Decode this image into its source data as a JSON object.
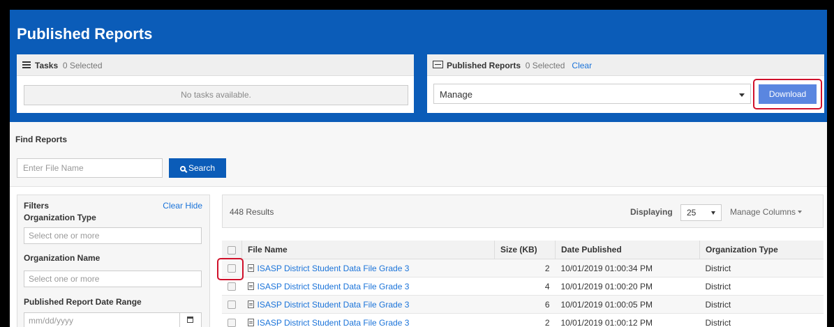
{
  "page": {
    "title": "Published Reports"
  },
  "tasks": {
    "title": "Tasks",
    "selected": "0 Selected",
    "empty": "No tasks available."
  },
  "published": {
    "title": "Published Reports",
    "selected": "0 Selected",
    "clear": "Clear",
    "manage_value": "Manage",
    "download_label": "Download"
  },
  "find": {
    "title": "Find Reports",
    "placeholder": "Enter File Name",
    "search_label": "Search"
  },
  "filters": {
    "title": "Filters",
    "clear": "Clear",
    "hide": "Hide",
    "org_type_label": "Organization Type",
    "org_type_placeholder": "Select one or more",
    "org_name_label": "Organization Name",
    "org_name_placeholder": "Select one or more",
    "date_label": "Published Report Date Range",
    "date_placeholder": "mm/dd/yyyy"
  },
  "results": {
    "count": "448 Results",
    "displaying_label": "Displaying",
    "displaying_value": "25",
    "manage_columns": "Manage Columns",
    "headers": {
      "file": "File Name",
      "size": "Size (KB)",
      "date": "Date Published",
      "org": "Organization Type"
    },
    "rows": [
      {
        "file": "ISASP District Student Data File Grade 3",
        "size": "2",
        "date": "10/01/2019 01:00:34 PM",
        "org": "District"
      },
      {
        "file": "ISASP District Student Data File Grade 3",
        "size": "4",
        "date": "10/01/2019 01:00:20 PM",
        "org": "District"
      },
      {
        "file": "ISASP District Student Data File Grade 3",
        "size": "6",
        "date": "10/01/2019 01:00:05 PM",
        "org": "District"
      },
      {
        "file": "ISASP District Student Data File Grade 3",
        "size": "2",
        "date": "10/01/2019 01:00:12 PM",
        "org": "District"
      }
    ]
  },
  "colors": {
    "brand": "#0b5cb8",
    "button": "#5a86e0",
    "highlight": "#d0112b",
    "link": "#1a73d9"
  }
}
